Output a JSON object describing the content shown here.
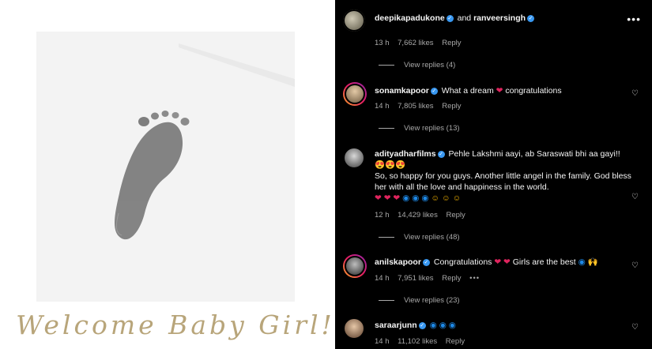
{
  "post": {
    "caption_text": "Welcome Baby Girl!"
  },
  "comments": [
    {
      "username": "deepikapadukone",
      "and_text": "and",
      "coauthor": "ranveersingh",
      "time": "13 h",
      "likes": "7,662 likes",
      "reply": "Reply",
      "view_replies": "View replies (4)"
    },
    {
      "username": "sonamkapoor",
      "text_before": "What a dream",
      "text_after": "congratulations",
      "time": "14 h",
      "likes": "7,805 likes",
      "reply": "Reply",
      "view_replies": "View replies (13)"
    },
    {
      "username": "adityadharfilms",
      "text_1": "Pehle Lakshmi aayi, ab Saraswati bhi aa gayi!!",
      "text_2": "So, so happy for you guys. Another little angel in the family. God bless her with all the love and happiness in the world.",
      "time": "12 h",
      "likes": "14,429 likes",
      "reply": "Reply",
      "view_replies": "View replies (48)"
    },
    {
      "username": "anilskapoor",
      "text_1": "Congratulations",
      "text_2": "Girls are the best",
      "time": "14 h",
      "likes": "7,951 likes",
      "reply": "Reply",
      "more": "•••",
      "view_replies": "View replies (23)"
    },
    {
      "username": "saraarjunn",
      "time": "14 h",
      "likes": "11,102 likes",
      "reply": "Reply"
    }
  ],
  "icons": {
    "verified": "verified-badge-icon",
    "heart": "heart-outline-icon",
    "more": "more-options-icon"
  },
  "colors": {
    "panel_bg": "#000000",
    "verified": "#3897f0",
    "caption_gold": "#b8a57a"
  }
}
